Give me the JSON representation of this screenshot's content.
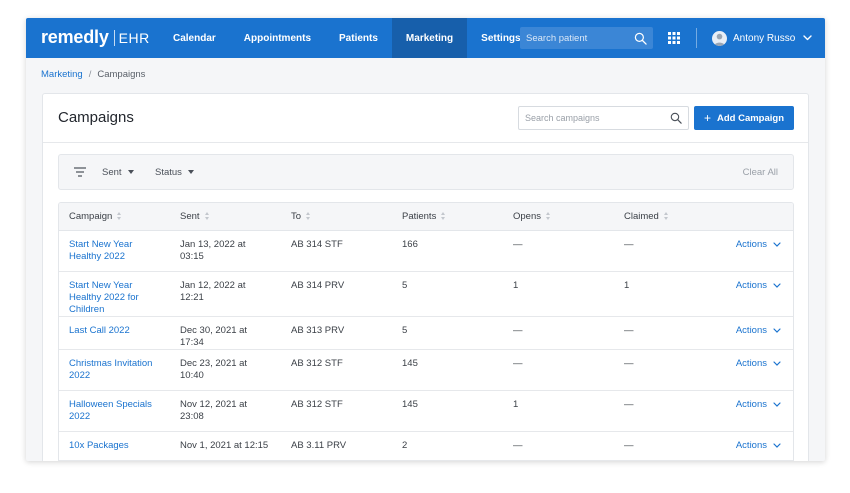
{
  "app": {
    "logo_main": "remedly",
    "logo_sub": "EHR"
  },
  "nav": {
    "items": [
      {
        "label": "Calendar",
        "active": false
      },
      {
        "label": "Appointments",
        "active": false
      },
      {
        "label": "Patients",
        "active": false
      },
      {
        "label": "Marketing",
        "active": true
      },
      {
        "label": "Settings",
        "active": false
      }
    ],
    "search_placeholder": "Search patient",
    "user_name": "Antony Russo"
  },
  "breadcrumb": {
    "parent": "Marketing",
    "separator": "/",
    "current": "Campaigns"
  },
  "page": {
    "title": "Campaigns",
    "search_placeholder": "Search campaigns",
    "add_label": "Add Campaign"
  },
  "filters": {
    "sent_label": "Sent",
    "status_label": "Status",
    "clear_label": "Clear All"
  },
  "table": {
    "columns": [
      "Campaign",
      "Sent",
      "To",
      "Patients",
      "Opens",
      "Claimed"
    ],
    "rows": [
      {
        "campaign": "Start New Year Healthy 2022",
        "sent": "Jan 13, 2022 at 03:15",
        "to": "AB 314 STF",
        "patients": "166",
        "opens": "—",
        "claimed": "—",
        "action": "Actions"
      },
      {
        "campaign": "Start New Year Healthy 2022 for Children",
        "sent": "Jan 12, 2022 at 12:21",
        "to": "AB 314 PRV",
        "patients": "5",
        "opens": "1",
        "claimed": "1",
        "action": "Actions"
      },
      {
        "campaign": "Last Call 2022",
        "sent": "Dec 30, 2021 at 17:34",
        "to": "AB 313 PRV",
        "patients": "5",
        "opens": "—",
        "claimed": "—",
        "action": "Actions"
      },
      {
        "campaign": "Christmas Invitation 2022",
        "sent": "Dec 23, 2021 at 10:40",
        "to": "AB 312 STF",
        "patients": "145",
        "opens": "—",
        "claimed": "—",
        "action": "Actions"
      },
      {
        "campaign": "Halloween Specials 2022",
        "sent": "Nov 12, 2021 at 23:08",
        "to": "AB 312 STF",
        "patients": "145",
        "opens": "1",
        "claimed": "—",
        "action": "Actions"
      },
      {
        "campaign": "10x Packages",
        "sent": "Nov 1, 2021 at 12:15",
        "to": "AB 3.11 PRV",
        "patients": "2",
        "opens": "—",
        "claimed": "—",
        "action": "Actions"
      }
    ]
  },
  "colors": {
    "brand": "#1a73cf",
    "nav_active": "#175fab"
  }
}
